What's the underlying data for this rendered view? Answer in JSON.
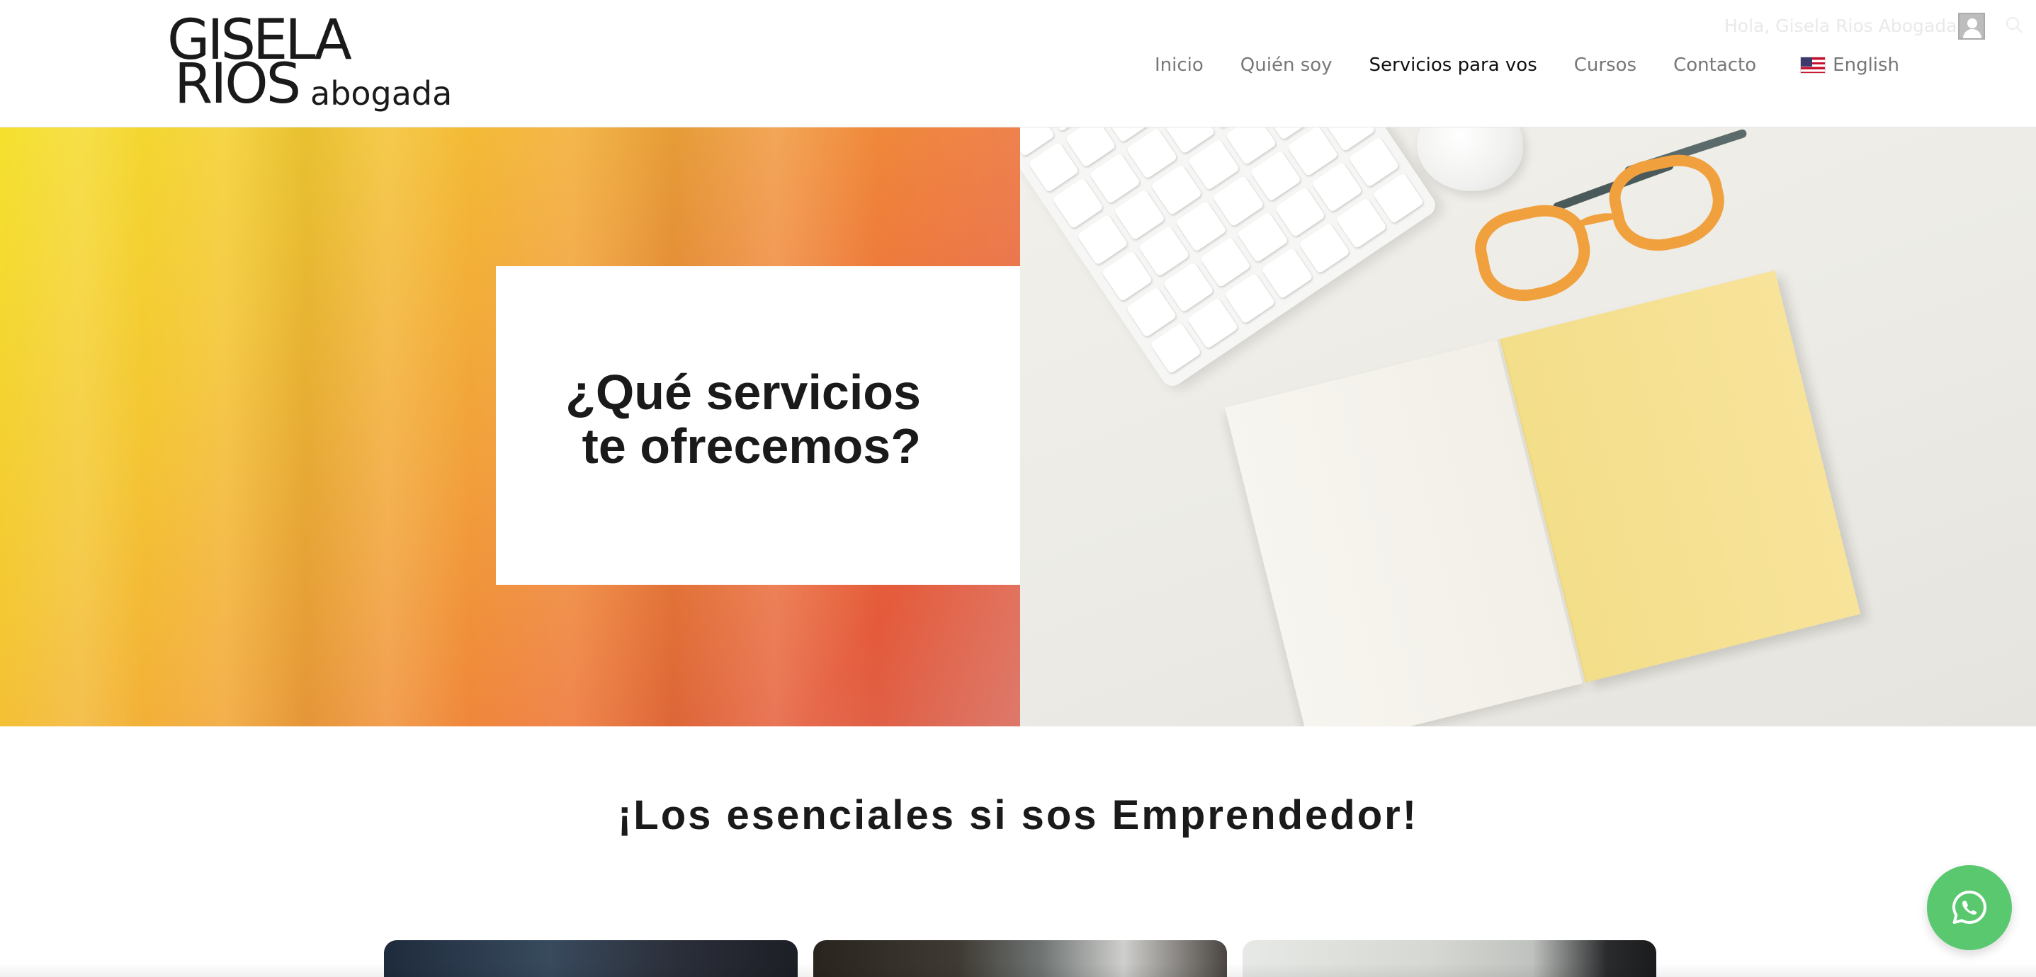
{
  "brand": {
    "logo_line1": "GISELA",
    "logo_line2": "RIOS",
    "logo_sub": "abogada"
  },
  "topbar": {
    "greeting": "Hola, Gisela Rios Abogada"
  },
  "nav": {
    "items": [
      {
        "label": "Inicio",
        "active": false
      },
      {
        "label": "Quién soy",
        "active": false
      },
      {
        "label": "Servicios para vos",
        "active": true
      },
      {
        "label": "Cursos",
        "active": false
      },
      {
        "label": "Contacto",
        "active": false
      }
    ],
    "language": "English"
  },
  "hero": {
    "title_line1": "¿Qué servicios",
    "title_line2": "te ofrecemos?"
  },
  "section": {
    "title": "¡Los esenciales si sos Emprendedor!"
  },
  "colors": {
    "whatsapp": "#5ac86f",
    "hero_gradient_start": "#f5e12e",
    "hero_gradient_end": "#e45a3a",
    "notebook_yellow": "#f8e39a",
    "glasses_orange": "#f0a13e"
  }
}
